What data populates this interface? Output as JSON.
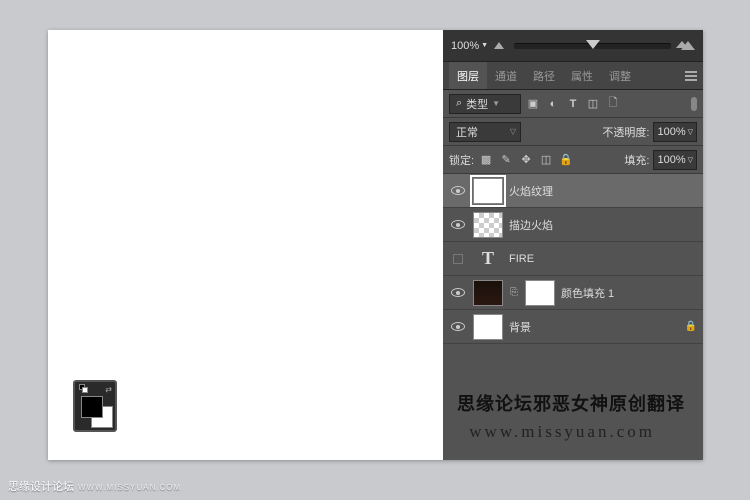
{
  "zoom": {
    "value": "100%"
  },
  "tabs": [
    "图层",
    "通道",
    "路径",
    "属性",
    "调整"
  ],
  "active_tab": "图层",
  "filter_row": {
    "search_icon": "⌕",
    "type_label": "类型",
    "icons": [
      "image",
      "adjust",
      "T",
      "crop",
      "smart"
    ]
  },
  "mode_row": {
    "blend_mode": "正常",
    "opacity_label": "不透明度:",
    "opacity_value": "100%"
  },
  "lock_row": {
    "lock_label": "锁定:",
    "fill_label": "填充:",
    "fill_value": "100%"
  },
  "layers": [
    {
      "visible": true,
      "thumb": "white",
      "selected": true,
      "name": "火焰纹理"
    },
    {
      "visible": true,
      "thumb": "checker",
      "name": "描边火焰"
    },
    {
      "visible": false,
      "thumb": "T",
      "name": "FIRE"
    },
    {
      "visible": true,
      "thumb": "dark",
      "linked": true,
      "mask": true,
      "name": "颜色填充 1"
    },
    {
      "visible": true,
      "thumb": "white",
      "name": "背景",
      "locked": true
    }
  ],
  "credit": {
    "text": "思缘论坛邪恶女神原创翻译",
    "url": "www.missyuan.com"
  },
  "footer": {
    "text": "思缘设计论坛",
    "small": "WWW.MISSYUAN.COM"
  }
}
